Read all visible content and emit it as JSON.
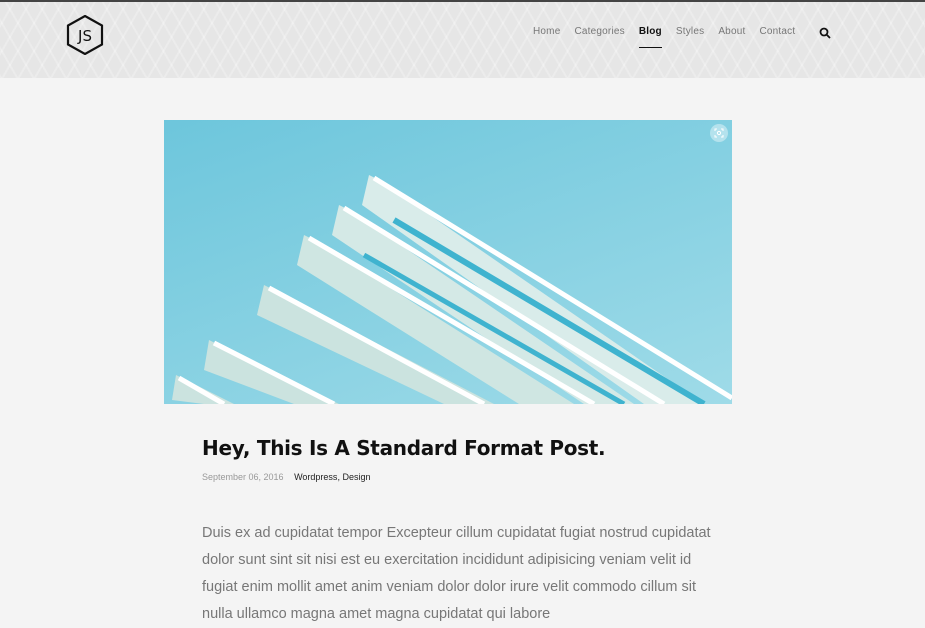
{
  "nav": {
    "items": [
      "Home",
      "Categories",
      "Blog",
      "Styles",
      "About",
      "Contact"
    ],
    "active": "Blog"
  },
  "logo": "JS",
  "post": {
    "title": "Hey, This Is A Standard Format Post.",
    "date": "September 06, 2016",
    "categories": [
      "Wordpress",
      "Design"
    ],
    "body": "Duis ex ad cupidatat tempor Excepteur cillum cupidatat fugiat nostrud cupidatat dolor sunt sint sit nisi est eu exercitation incididunt adipisicing veniam velit id fugiat enim mollit amet anim veniam dolor dolor irure velit commodo cillum sit nulla ullamco magna amet magna cupidatat qui labore"
  }
}
